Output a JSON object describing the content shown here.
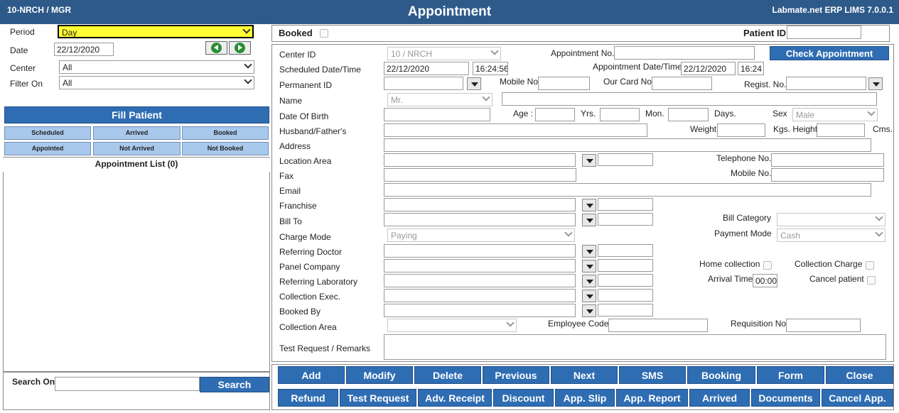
{
  "title_bar": {
    "left": "10-NRCH / MGR",
    "center": "Appointment",
    "right": "Labmate.net ERP LIMS 7.0.0.1"
  },
  "left": {
    "period_label": "Period",
    "period_value": "Day",
    "date_label": "Date",
    "date_value": "22/12/2020",
    "center_label": "Center",
    "center_value": "All",
    "filter_label": "Filter On",
    "filter_value": "All",
    "fill_patient": "Fill Patient",
    "filters": [
      "Scheduled",
      "Arrived",
      "Booked",
      "Appointed",
      "Not Arrived",
      "Not Booked"
    ],
    "list_title": "Appointment List (0)",
    "search_label": "Search On",
    "search_value": "",
    "search_button": "Search"
  },
  "header": {
    "booked_label": "Booked",
    "patient_id_label": "Patient ID",
    "patient_id_value": ""
  },
  "form": {
    "center_id_label": "Center ID",
    "center_id_value": "10 / NRCH",
    "appointment_no_label": "Appointment No.",
    "appointment_no_value": "",
    "check_appointment": "Check Appointment",
    "scheduled_label": "Scheduled Date/Time",
    "scheduled_date": "22/12/2020",
    "scheduled_time": "16:24:56",
    "appt_datetime_label": "Appointment Date/Time",
    "appt_date": "22/12/2020",
    "appt_time": "16:24",
    "permanent_id_label": "Permanent ID",
    "mobile_no_label": "Mobile No",
    "our_card_label": "Our Card No",
    "regist_no_label": "Regist. No.",
    "name_label": "Name",
    "title_value": "Mr.",
    "dob_label": "Date Of Birth",
    "age_label": "Age :",
    "yrs_label": "Yrs.",
    "mon_label": "Mon.",
    "days_label": "Days.",
    "sex_label": "Sex",
    "sex_value": "Male",
    "husband_label": "Husband/Father's",
    "weight_label": "Weight",
    "height_label": "Kgs. Height",
    "cms_label": "Cms.",
    "address_label": "Address",
    "location_label": "Location Area",
    "telephone_label": "Telephone No.",
    "fax_label": "Fax",
    "mobile_label": "Mobile No.",
    "email_label": "Email",
    "franchise_label": "Franchise",
    "bill_to_label": "Bill To",
    "bill_category_label": "Bill Category",
    "charge_mode_label": "Charge Mode",
    "charge_mode_value": "Paying",
    "payment_mode_label": "Payment Mode",
    "payment_mode_value": "Cash",
    "referring_doctor_label": "Referring Doctor",
    "home_collection_label": "Home collection",
    "collection_charge_label": "Collection Charge",
    "panel_company_label": "Panel Company",
    "referring_lab_label": "Referring Laboratory",
    "arrival_time_label": "Arrival Time",
    "arrival_time_value": "00:00",
    "cancel_patient_label": "Cancel patient",
    "collection_exec_label": "Collection Exec.",
    "booked_by_label": "Booked By",
    "collection_area_label": "Collection Area",
    "employee_code_label": "Employee Code",
    "requisition_label": "Requisition No",
    "remarks_label": "Test Request / Remarks"
  },
  "buttons_row1": [
    "Add",
    "Modify",
    "Delete",
    "Previous",
    "Next",
    "SMS",
    "Booking",
    "Form",
    "Close"
  ],
  "buttons_row2": [
    "Refund",
    "Test Request",
    "Adv. Receipt",
    "Discount",
    "App. Slip",
    "App. Report",
    "Arrived",
    "Documents",
    "Cancel App."
  ]
}
